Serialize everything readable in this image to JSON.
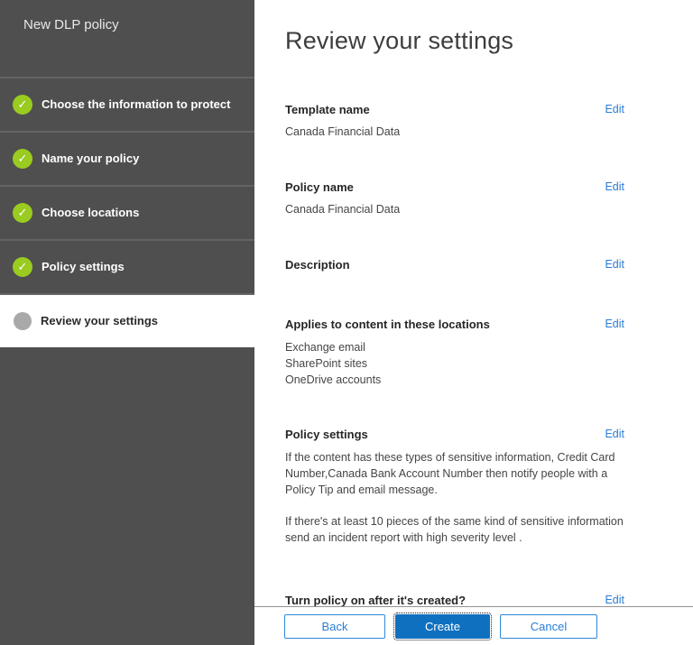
{
  "window_title": "New DLP policy",
  "sidebar": {
    "title": "New DLP policy",
    "steps": [
      {
        "label": "Choose the information to protect",
        "state": "complete"
      },
      {
        "label": "Name your policy",
        "state": "complete"
      },
      {
        "label": "Choose locations",
        "state": "complete"
      },
      {
        "label": "Policy settings",
        "state": "complete"
      },
      {
        "label": "Review your settings",
        "state": "current"
      }
    ],
    "check_icon": "✓"
  },
  "main": {
    "heading": "Review your settings",
    "edit_label": "Edit",
    "sections": [
      {
        "title": "Template name",
        "lines": [
          "Canada Financial Data"
        ]
      },
      {
        "title": "Policy name",
        "lines": [
          "Canada Financial Data"
        ]
      },
      {
        "title": "Description",
        "lines": []
      },
      {
        "title": "Applies to content in these locations",
        "lines": [
          "Exchange email",
          "SharePoint sites",
          "OneDrive accounts"
        ]
      },
      {
        "title": "Policy settings",
        "paragraphs": [
          "If the content has these types of sensitive information, Credit Card Number,Canada Bank Account Number then notify people with a Policy Tip and email message.",
          "If there's at least 10 pieces of the same kind of sensitive information send an incident report with high severity level ."
        ]
      },
      {
        "title": "Turn policy on after it's created?",
        "lines": []
      }
    ]
  },
  "footer": {
    "back_label": "Back",
    "create_label": "Create",
    "cancel_label": "Cancel"
  },
  "colors": {
    "sidebar-bg": "#4f4f4f",
    "green": "#9acb20",
    "gray-dot": "#a9a9a9",
    "link-blue": "#2b7cd3",
    "button-blue": "#1070c0",
    "button-border-blue": "#2f88d8"
  }
}
